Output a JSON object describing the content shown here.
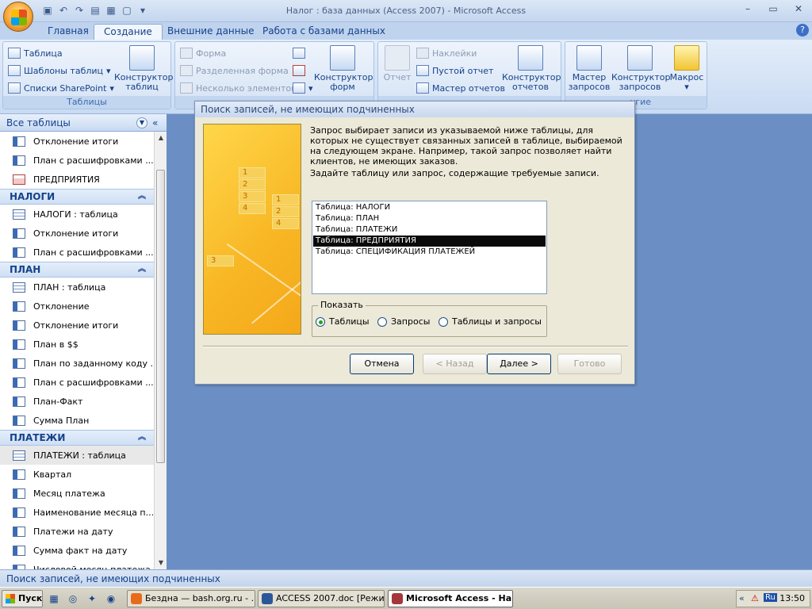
{
  "window": {
    "title": "Налог : база данных (Access 2007) - Microsoft Access",
    "minimize": "–",
    "maximize": "▭",
    "close": "✕"
  },
  "tabs": [
    "Главная",
    "Создание",
    "Внешние данные",
    "Работа с базами данных"
  ],
  "active_tab": "Создание",
  "ribbon": {
    "tables": {
      "table": "Таблица",
      "templates": "Шаблоны таблиц",
      "sharepoint": "Списки SharePoint",
      "designer": [
        "Конструктор",
        "таблиц"
      ],
      "label": "Таблицы"
    },
    "forms": {
      "form": "Форма",
      "split_form": "Разделенная форма",
      "multiple_items": "Несколько элементов",
      "designer": [
        "Конструктор",
        "форм"
      ]
    },
    "reports": {
      "report": "Отчет",
      "labels": "Наклейки",
      "blank_report": "Пустой отчет",
      "report_wizard": "Мастер отчетов",
      "designer": [
        "Конструктор",
        "отчетов"
      ]
    },
    "other": {
      "query_wizard": [
        "Мастер",
        "запросов"
      ],
      "query_designer": [
        "Конструктор",
        "запросов"
      ],
      "macro": "Макрос",
      "label_partial": "угие"
    }
  },
  "nav": {
    "header": "Все таблицы",
    "top_items": [
      {
        "label": "Отклонение итоги",
        "icon": "query"
      },
      {
        "label": "План с расшифровками ...",
        "icon": "query"
      },
      {
        "label": "ПРЕДПРИЯТИЯ",
        "icon": "form"
      }
    ],
    "groups": [
      {
        "name": "НАЛОГИ",
        "items": [
          {
            "label": "НАЛОГИ : таблица",
            "icon": "table"
          },
          {
            "label": "Отклонение итоги",
            "icon": "query"
          },
          {
            "label": "План с расшифровками ...",
            "icon": "query"
          }
        ]
      },
      {
        "name": "ПЛАН",
        "items": [
          {
            "label": "ПЛАН : таблица",
            "icon": "table"
          },
          {
            "label": "Отклонение",
            "icon": "query"
          },
          {
            "label": "Отклонение итоги",
            "icon": "query"
          },
          {
            "label": "План в $$",
            "icon": "query"
          },
          {
            "label": "План по заданному коду ...",
            "icon": "query"
          },
          {
            "label": "План с расшифровками ...",
            "icon": "query"
          },
          {
            "label": "План-Факт",
            "icon": "query"
          },
          {
            "label": "Сумма План",
            "icon": "query"
          }
        ]
      },
      {
        "name": "ПЛАТЕЖИ",
        "items": [
          {
            "label": "ПЛАТЕЖИ : таблица",
            "icon": "table",
            "selected": true
          },
          {
            "label": "Квартал",
            "icon": "query"
          },
          {
            "label": "Месяц платежа",
            "icon": "query"
          },
          {
            "label": "Наименование месяца п...",
            "icon": "query"
          },
          {
            "label": "Платежи на дату",
            "icon": "query"
          },
          {
            "label": "Сумма факт на дату",
            "icon": "query"
          },
          {
            "label": "Числовой месяц платежа",
            "icon": "query"
          }
        ]
      }
    ]
  },
  "dialog": {
    "title": "Поиск записей, не имеющих подчиненных",
    "description": "Запрос выбирает записи из указываемой ниже таблицы, для которых не существует связанных записей в таблице, выбираемой на следующем экране. Например, такой запрос позволяет найти клиентов, не имеющих заказов.",
    "instruction": "Задайте таблицу или запрос, содержащие требуемые записи.",
    "list": [
      "Таблица: НАЛОГИ",
      "Таблица: ПЛАН",
      "Таблица: ПЛАТЕЖИ",
      "Таблица: ПРЕДПРИЯТИЯ",
      "Таблица: СПЕЦИФИКАЦИЯ ПЛАТЕЖЕЙ"
    ],
    "selected_index": 3,
    "show_label": "Показать",
    "show_options": [
      "Таблицы",
      "Запросы",
      "Таблицы и запросы"
    ],
    "show_selected": 0,
    "buttons": {
      "cancel": "Отмена",
      "back": "< Назад",
      "next": "Далее >",
      "finish": "Готово"
    },
    "art_numbers": [
      "1",
      "2",
      "3",
      "4",
      "1",
      "2",
      "4",
      "3"
    ]
  },
  "statusbar": {
    "text": "Поиск записей, не имеющих подчиненных"
  },
  "taskbar": {
    "start": "Пуск",
    "tasks": [
      {
        "label": "Бездна — bash.org.ru - ...",
        "color": "#e86b1c"
      },
      {
        "label": "ACCESS 2007.doc [Режи...",
        "color": "#2b579a"
      },
      {
        "label": "Microsoft Access - На...",
        "color": "#a4373a",
        "active": true
      }
    ],
    "lang": "Ru",
    "clock": "13:50"
  }
}
